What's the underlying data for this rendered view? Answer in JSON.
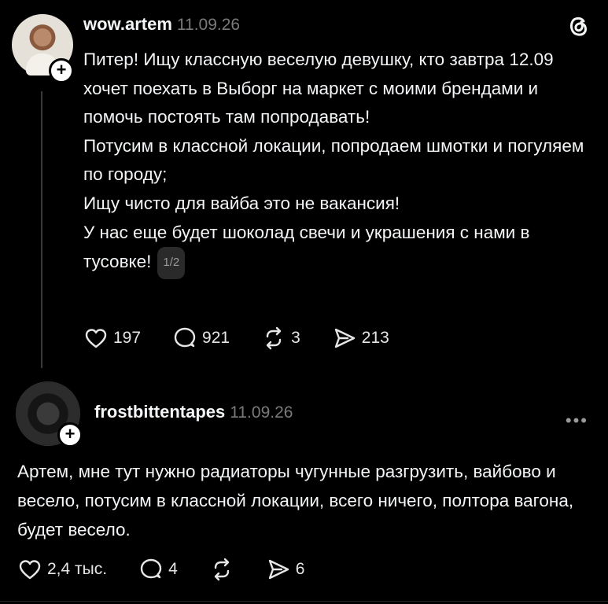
{
  "post": {
    "username": "wow.artem",
    "date": "11.09.26",
    "lines": [
      "Питер! Ищу классную веселую девушку, кто завтра 12.09 хочет поехать в Выборг на маркет с моими брендами и помочь постоять там попродавать!",
      "Потусим в классной локации, попродаем шмотки и погуляем по городу;",
      "Ищу чисто для вайба это не вакансия!",
      "У нас еще будет шоколад свечи и украшения с нами в тусовке!"
    ],
    "page_badge": "1/2",
    "likes": "197",
    "comments": "921",
    "reposts": "3",
    "shares": "213"
  },
  "reply": {
    "username": "frostbittentapes",
    "date": "11.09.26",
    "text": "Артем, мне тут нужно радиаторы чугунные разгрузить, вайбово и весело, потусим в классной локации, всего ничего, полтора вагона, будет весело.",
    "likes": "2,4 тыс.",
    "comments": "4",
    "shares": "6"
  },
  "icons": {
    "app_logo": "threads-logo-icon",
    "more": "more-dots-icon",
    "like": "heart-icon",
    "comment": "comment-bubble-icon",
    "repost": "repost-icon",
    "share": "send-icon",
    "follow": "plus-icon"
  },
  "colors": {
    "background": "#000000",
    "text": "#f3f5f7",
    "muted": "#7a7a7a"
  }
}
